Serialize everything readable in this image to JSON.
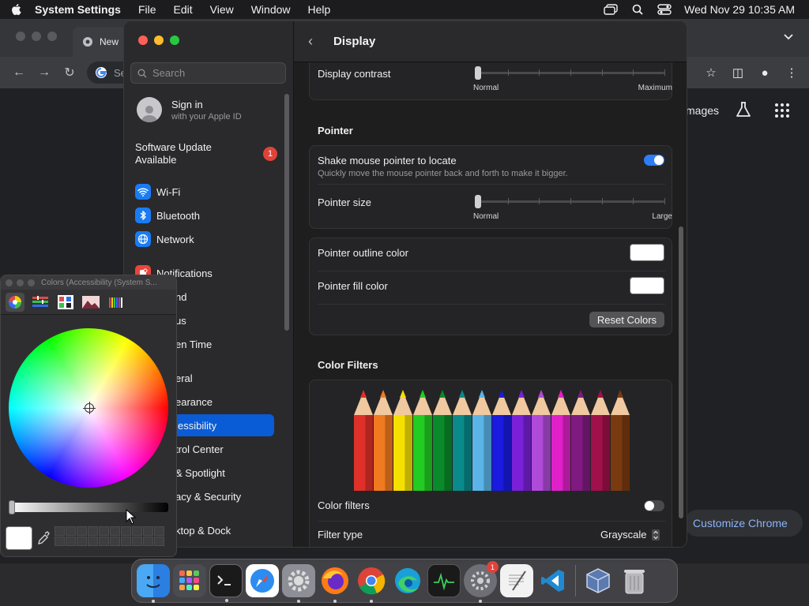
{
  "menubar": {
    "app_name": "System Settings",
    "items": [
      "File",
      "Edit",
      "View",
      "Window",
      "Help"
    ],
    "clock": "Wed Nov 29  10:35 AM"
  },
  "chrome": {
    "tab_title": "New",
    "omnibox_text": "Se",
    "images_link": "mages",
    "customize_button": "Customize Chrome"
  },
  "sidebar": {
    "search_placeholder": "Search",
    "signin_title": "Sign in",
    "signin_sub": "with your Apple ID",
    "update_label": "Software Update Available",
    "update_badge": "1",
    "items": [
      {
        "label": "Wi-Fi",
        "icon": "wifi-icon",
        "color": "#1a7cf5"
      },
      {
        "label": "Bluetooth",
        "icon": "bluetooth-icon",
        "color": "#1a7cf5"
      },
      {
        "label": "Network",
        "icon": "globe-icon",
        "color": "#1a7cf5"
      },
      {
        "label": "Notifications",
        "icon": "bell-icon",
        "color": "#e8453c"
      },
      {
        "label": "nd",
        "icon": "",
        "color": ""
      },
      {
        "label": "us",
        "icon": "",
        "color": ""
      },
      {
        "label": "en Time",
        "icon": "",
        "color": ""
      },
      {
        "label": "eral",
        "icon": "",
        "color": ""
      },
      {
        "label": "earance",
        "icon": "",
        "color": ""
      },
      {
        "label": "essibility",
        "icon": "",
        "color": ""
      },
      {
        "label": "trol Center",
        "icon": "",
        "color": ""
      },
      {
        "label": "& Spotlight",
        "icon": "",
        "color": ""
      },
      {
        "label": "acy & Security",
        "icon": "",
        "color": ""
      },
      {
        "label": "ktop & Dock",
        "icon": "",
        "color": ""
      }
    ]
  },
  "content": {
    "title": "Display",
    "display_contrast": {
      "label": "Display contrast",
      "min_label": "Normal",
      "max_label": "Maximum",
      "value": 0
    },
    "pointer_section": "Pointer",
    "shake": {
      "label": "Shake mouse pointer to locate",
      "sub": "Quickly move the mouse pointer back and forth to make it bigger.",
      "on": true
    },
    "pointer_size": {
      "label": "Pointer size",
      "min_label": "Normal",
      "max_label": "Large",
      "value": 0
    },
    "outline_color": {
      "label": "Pointer outline color",
      "color": "#ffffff"
    },
    "fill_color": {
      "label": "Pointer fill color",
      "color": "#ffffff"
    },
    "reset_button": "Reset Colors",
    "filters_section": "Color Filters",
    "color_filters": {
      "label": "Color filters",
      "on": false
    },
    "filter_type": {
      "label": "Filter type",
      "value": "Grayscale"
    },
    "pencil_colors": [
      "#e0302a",
      "#f07a20",
      "#f5e000",
      "#22cc22",
      "#0a8a2a",
      "#0a8a8a",
      "#5ab4e8",
      "#1a1ae0",
      "#7a20d8",
      "#b04ad8",
      "#e020c8",
      "#801a80",
      "#a0104a",
      "#7a3a10"
    ]
  },
  "colors_panel": {
    "title": "Colors (Accessibility (System S..."
  },
  "accent_color": "#0a5bd6",
  "toggle_on_color": "#2f7df6"
}
